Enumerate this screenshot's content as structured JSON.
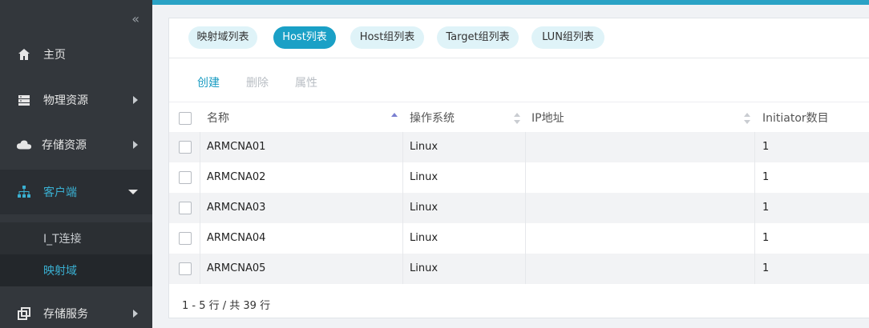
{
  "sidebar": {
    "collapse_icon": "double-chevron-left-icon",
    "items": [
      {
        "label": "主页",
        "icon": "home-icon"
      },
      {
        "label": "物理资源",
        "icon": "server-icon"
      },
      {
        "label": "存储资源",
        "icon": "cloud-icon"
      },
      {
        "label": "客户端",
        "icon": "sitemap-icon"
      },
      {
        "label": "存储服务",
        "icon": "copy-icon"
      }
    ],
    "sub_items": [
      {
        "label": "I_T连接"
      },
      {
        "label": "映射域"
      }
    ]
  },
  "tabs": [
    {
      "label": "映射域列表"
    },
    {
      "label": "Host列表"
    },
    {
      "label": "Host组列表"
    },
    {
      "label": "Target组列表"
    },
    {
      "label": "LUN组列表"
    }
  ],
  "actions": {
    "create": "创建",
    "delete": "删除",
    "properties": "属性"
  },
  "table": {
    "columns": [
      "名称",
      "操作系统",
      "IP地址",
      "Initiator数目"
    ],
    "rows": [
      {
        "name": "ARMCNA01",
        "os": "Linux",
        "ip": "",
        "initiators": "1"
      },
      {
        "name": "ARMCNA02",
        "os": "Linux",
        "ip": "",
        "initiators": "1"
      },
      {
        "name": "ARMCNA03",
        "os": "Linux",
        "ip": "",
        "initiators": "1"
      },
      {
        "name": "ARMCNA04",
        "os": "Linux",
        "ip": "",
        "initiators": "1"
      },
      {
        "name": "ARMCNA05",
        "os": "Linux",
        "ip": "",
        "initiators": "1"
      }
    ]
  },
  "pagination": {
    "summary": "1 - 5 行 / 共 39 行"
  },
  "colors": {
    "accent": "#1aa0c6",
    "sidebar_bg": "#33373c",
    "active_text": "#3ab0d2"
  }
}
